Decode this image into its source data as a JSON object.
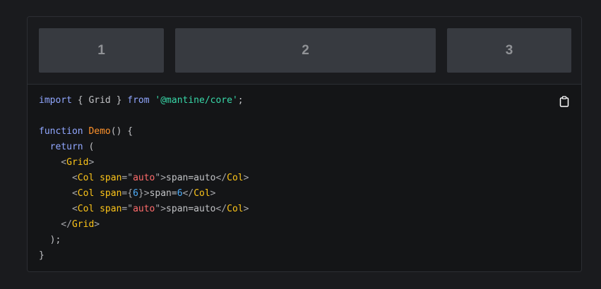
{
  "preview": {
    "cols": [
      {
        "label": "1"
      },
      {
        "label": "2"
      },
      {
        "label": "3"
      }
    ]
  },
  "code": {
    "lines": [
      [
        {
          "t": "import",
          "c": "kw"
        },
        {
          "t": " { Grid } ",
          "c": ""
        },
        {
          "t": "from",
          "c": "kw"
        },
        {
          "t": " ",
          "c": ""
        },
        {
          "t": "'@mantine/core'",
          "c": "str"
        },
        {
          "t": ";",
          "c": ""
        }
      ],
      [],
      [
        {
          "t": "function",
          "c": "kw"
        },
        {
          "t": " ",
          "c": ""
        },
        {
          "t": "Demo",
          "c": "fn"
        },
        {
          "t": "() {",
          "c": ""
        }
      ],
      [
        {
          "t": "  ",
          "c": ""
        },
        {
          "t": "return",
          "c": "kw"
        },
        {
          "t": " (",
          "c": ""
        }
      ],
      [
        {
          "t": "    <",
          "c": "punc"
        },
        {
          "t": "Grid",
          "c": "tag"
        },
        {
          "t": ">",
          "c": "punc"
        }
      ],
      [
        {
          "t": "      <",
          "c": "punc"
        },
        {
          "t": "Col",
          "c": "tag"
        },
        {
          "t": " ",
          "c": ""
        },
        {
          "t": "span",
          "c": "attr"
        },
        {
          "t": "=\"",
          "c": "punc"
        },
        {
          "t": "auto",
          "c": "val"
        },
        {
          "t": "\">",
          "c": "punc"
        },
        {
          "t": "span=auto",
          "c": ""
        },
        {
          "t": "</",
          "c": "punc"
        },
        {
          "t": "Col",
          "c": "tag"
        },
        {
          "t": ">",
          "c": "punc"
        }
      ],
      [
        {
          "t": "      <",
          "c": "punc"
        },
        {
          "t": "Col",
          "c": "tag"
        },
        {
          "t": " ",
          "c": ""
        },
        {
          "t": "span",
          "c": "attr"
        },
        {
          "t": "={",
          "c": "punc"
        },
        {
          "t": "6",
          "c": "num"
        },
        {
          "t": "}>",
          "c": "punc"
        },
        {
          "t": "span=",
          "c": ""
        },
        {
          "t": "6",
          "c": "num"
        },
        {
          "t": "</",
          "c": "punc"
        },
        {
          "t": "Col",
          "c": "tag"
        },
        {
          "t": ">",
          "c": "punc"
        }
      ],
      [
        {
          "t": "      <",
          "c": "punc"
        },
        {
          "t": "Col",
          "c": "tag"
        },
        {
          "t": " ",
          "c": ""
        },
        {
          "t": "span",
          "c": "attr"
        },
        {
          "t": "=\"",
          "c": "punc"
        },
        {
          "t": "auto",
          "c": "val"
        },
        {
          "t": "\">",
          "c": "punc"
        },
        {
          "t": "span=auto",
          "c": ""
        },
        {
          "t": "</",
          "c": "punc"
        },
        {
          "t": "Col",
          "c": "tag"
        },
        {
          "t": ">",
          "c": "punc"
        }
      ],
      [
        {
          "t": "    </",
          "c": "punc"
        },
        {
          "t": "Grid",
          "c": "tag"
        },
        {
          "t": ">",
          "c": "punc"
        }
      ],
      [
        {
          "t": "  );",
          "c": ""
        }
      ],
      [
        {
          "t": "}",
          "c": ""
        }
      ]
    ]
  },
  "copy_icon": "clipboard-icon"
}
